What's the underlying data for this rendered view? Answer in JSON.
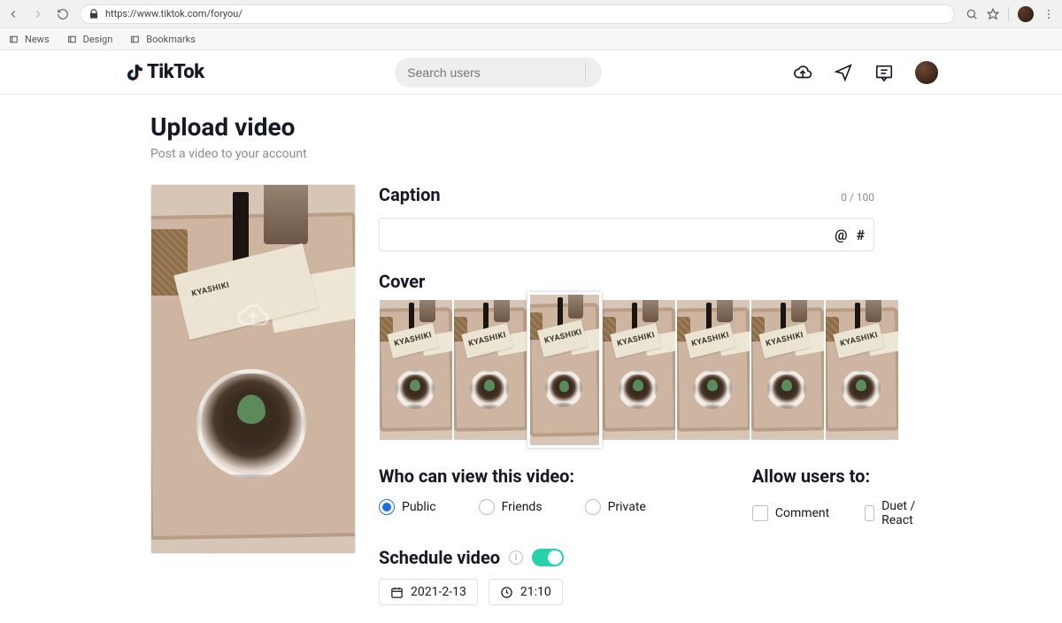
{
  "browser": {
    "url": "https://www.tiktok.com/foryou/",
    "bookmarks": [
      "News",
      "Design",
      "Bookmarks"
    ]
  },
  "header": {
    "brand": "TikTok",
    "search_placeholder": "Search users"
  },
  "page": {
    "title": "Upload video",
    "subtitle": "Post a video to your account"
  },
  "preview": {
    "card_text": "KYASHIKI"
  },
  "caption": {
    "label": "Caption",
    "counter": "0 / 100",
    "value": ""
  },
  "cover": {
    "label": "Cover",
    "selected_index": 2,
    "frame_count": 7
  },
  "visibility": {
    "label": "Who can view this video:",
    "options": [
      "Public",
      "Friends",
      "Private"
    ],
    "selected": "Public"
  },
  "allow": {
    "label": "Allow users to:",
    "options": [
      "Comment",
      "Duet / React"
    ]
  },
  "schedule": {
    "label": "Schedule video",
    "enabled": true,
    "date": "2021-2-13",
    "time": "21:10"
  }
}
